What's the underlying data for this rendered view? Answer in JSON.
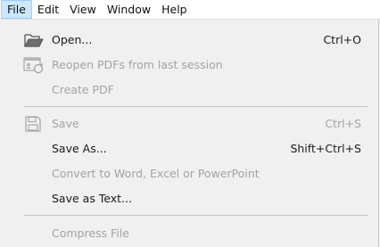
{
  "menubar": {
    "items": [
      {
        "label": "File"
      },
      {
        "label": "Edit"
      },
      {
        "label": "View"
      },
      {
        "label": "Window"
      },
      {
        "label": "Help"
      }
    ]
  },
  "file_menu": {
    "items": [
      {
        "label": "Open...",
        "shortcut": "Ctrl+O",
        "enabled": true,
        "icon": "open-folder-icon"
      },
      {
        "label": "Reopen PDFs from last session",
        "shortcut": "",
        "enabled": false,
        "icon": "reopen-session-icon"
      },
      {
        "label": "Create PDF",
        "shortcut": "",
        "enabled": false
      },
      {
        "label": "Save",
        "shortcut": "Ctrl+S",
        "enabled": false,
        "icon": "save-disk-icon"
      },
      {
        "label": "Save As...",
        "shortcut": "Shift+Ctrl+S",
        "enabled": true
      },
      {
        "label": "Convert to Word, Excel or PowerPoint",
        "shortcut": "",
        "enabled": false
      },
      {
        "label": "Save as Text...",
        "shortcut": "",
        "enabled": true
      },
      {
        "label": "Compress File",
        "shortcut": "",
        "enabled": false
      }
    ]
  },
  "colors": {
    "menu_bg": "#f0f0f0",
    "active_menu_bg": "#cce8ff",
    "disabled_text": "#a3a3a3",
    "text": "#1a1a1a"
  }
}
